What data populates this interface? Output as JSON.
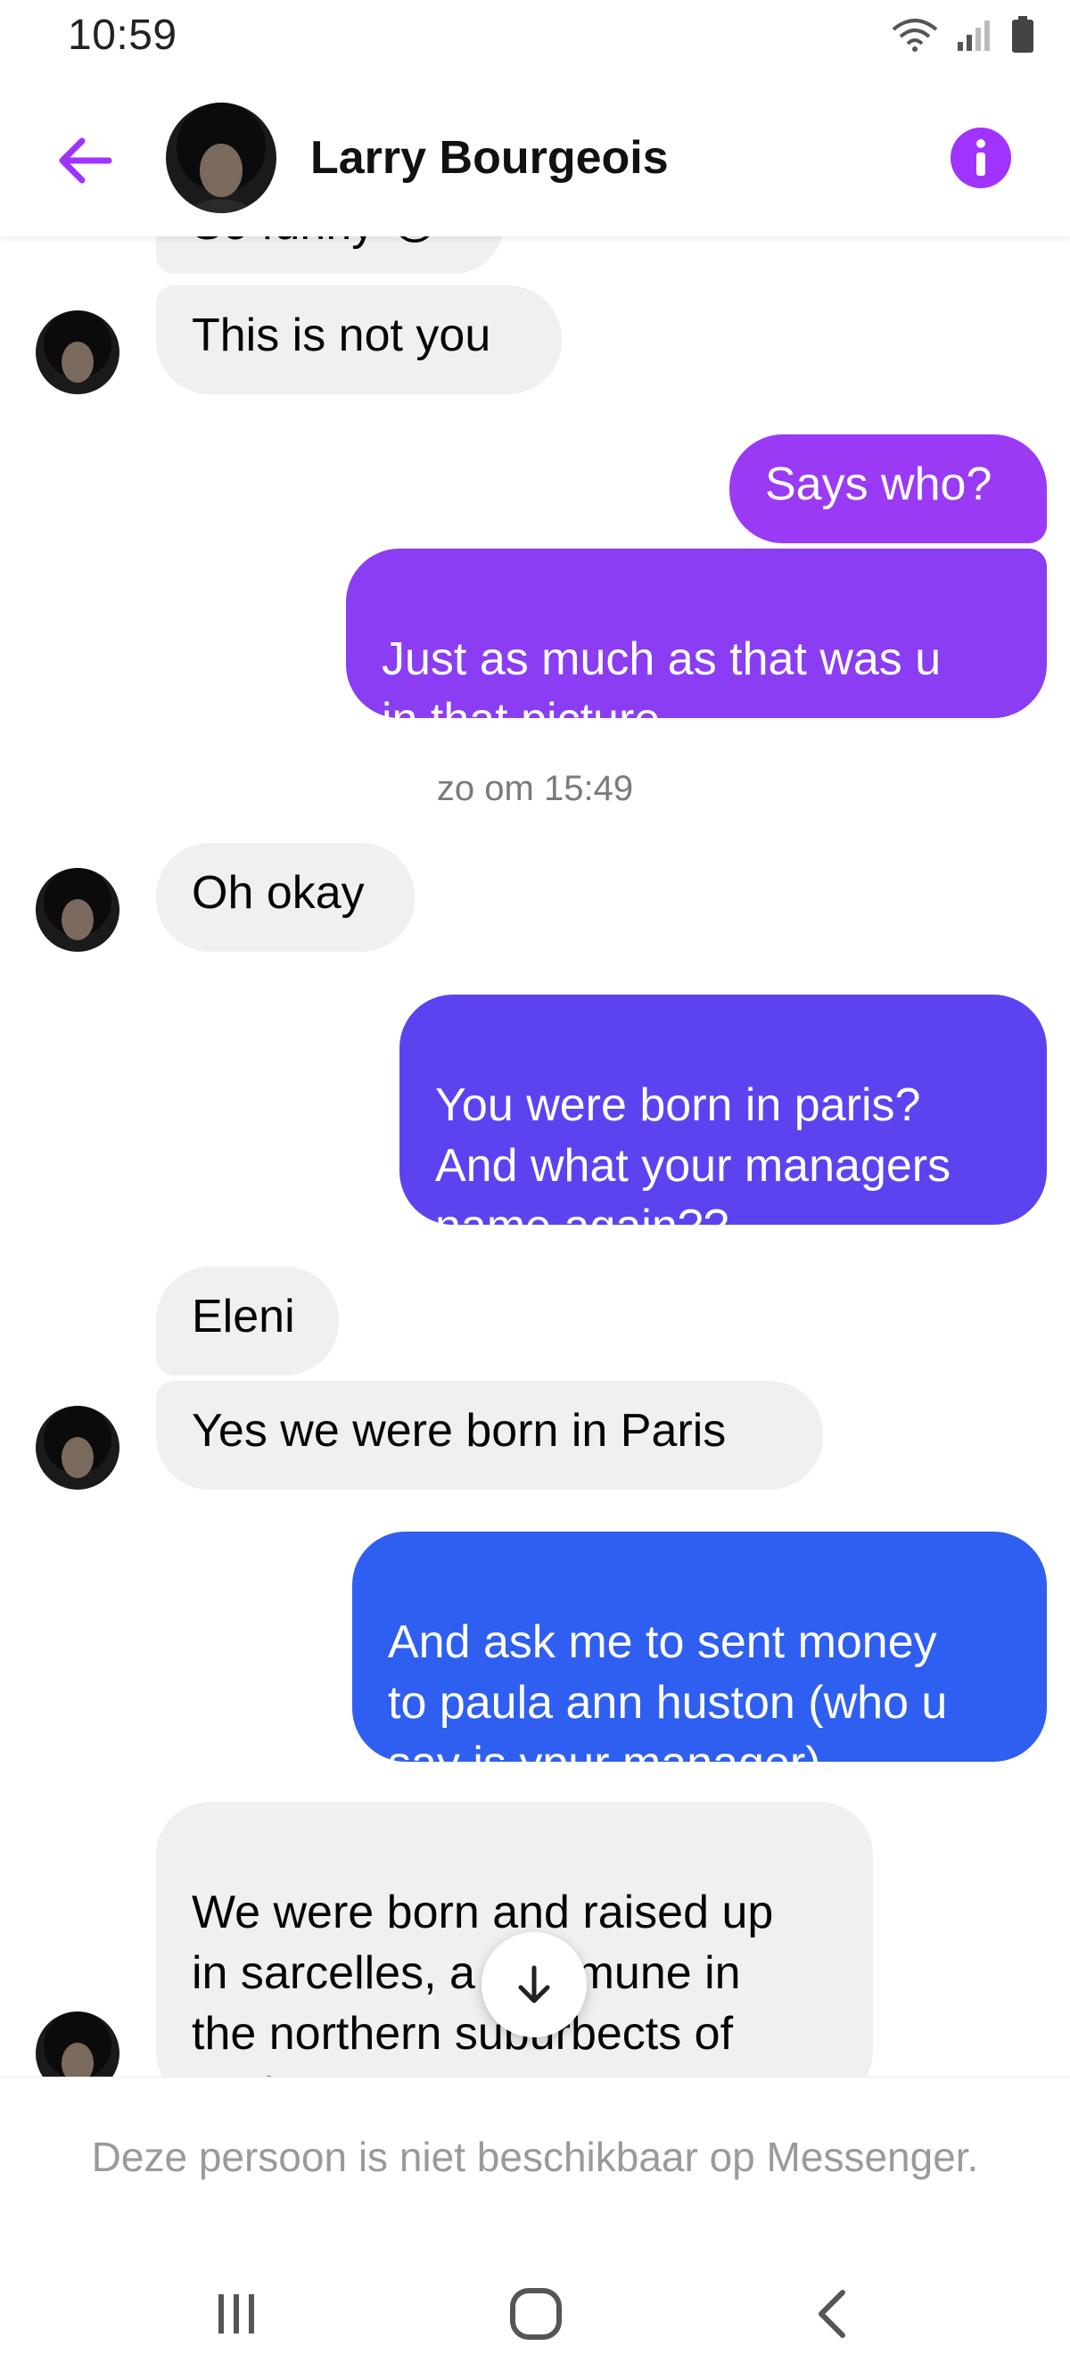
{
  "status_bar": {
    "time": "10:59"
  },
  "header": {
    "contact_name": "Larry Bourgeois"
  },
  "icons": {
    "back": "arrow-left-icon",
    "info": "info-icon",
    "scroll_down": "arrow-down-icon",
    "nav_recents": "recents-icon",
    "nav_home": "home-icon",
    "nav_back": "chevron-left-icon"
  },
  "colors": {
    "accent": "#a033ff",
    "bubble_incoming": "#f0f0f0",
    "bubble_out_1": "#8a3df2",
    "bubble_out_2": "#5b44f0",
    "bubble_out_3": "#2f5ff0"
  },
  "messages": [
    {
      "from": "contact",
      "text": "So funny 😂"
    },
    {
      "from": "contact",
      "text": "This is not you"
    },
    {
      "from": "me",
      "text": "Says who?"
    },
    {
      "from": "me",
      "text": "Just as much as that was u\nin that picture"
    },
    {
      "from": "timestamp",
      "text": "zo om 15:49"
    },
    {
      "from": "contact",
      "text": "Oh okay"
    },
    {
      "from": "me",
      "text": "You were born in paris?\nAnd what your managers\nname again??"
    },
    {
      "from": "contact",
      "text": "Eleni"
    },
    {
      "from": "contact",
      "text": "Yes we were born in Paris"
    },
    {
      "from": "me",
      "text": "And ask me to sent money\nto paula ann huston (who u\nsay is ypur manager)"
    },
    {
      "from": "contact",
      "text": "We were born and raised up\nin sarcelles, a commune in\nthe northern suburbects of\nParis France"
    }
  ],
  "footer": {
    "notice": "Deze persoon is niet beschikbaar op Messenger."
  }
}
